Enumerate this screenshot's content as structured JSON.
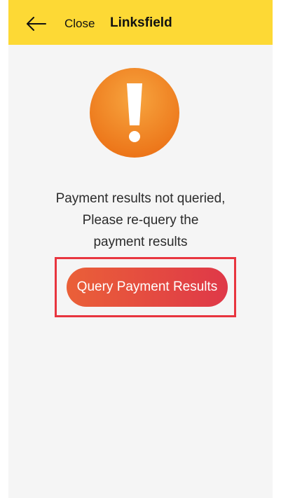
{
  "header": {
    "back_icon": "arrow-left-icon",
    "close_label": "Close",
    "title": "Linksfield"
  },
  "alert": {
    "icon": "exclamation-warning-icon",
    "message_lines": [
      "Payment results not queried,",
      "Please re-query the",
      "payment results"
    ]
  },
  "actions": {
    "query_label": "Query Payment Results"
  },
  "colors": {
    "header_background": "#fdd935",
    "page_background": "#f5f5f5",
    "icon_orange": "#f08a24",
    "button_gradient_start": "#ea6038",
    "button_gradient_end": "#df3848",
    "highlight_border": "#e8353f"
  }
}
